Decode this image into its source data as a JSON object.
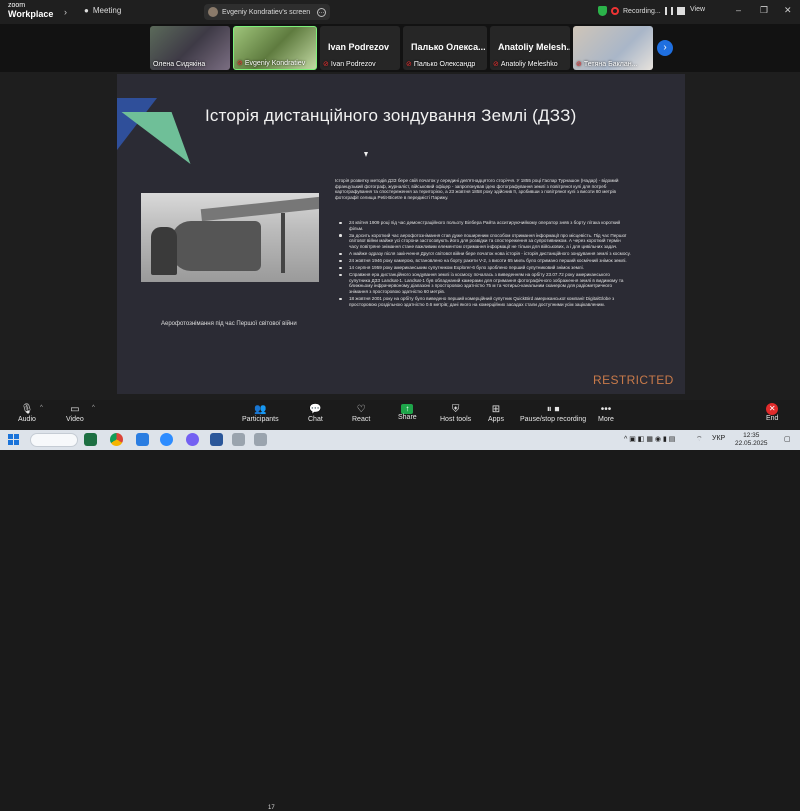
{
  "app": {
    "logo_line1": "zoom",
    "logo_line2": "Workplace",
    "meeting_label": "Meeting",
    "screen_pill": "Evgeniy Kondratiev's screen",
    "recording_label": "Recording...",
    "view_label": "View"
  },
  "participants": [
    {
      "name": "Олена Сидякіна",
      "muted": false
    },
    {
      "name": "Evgeniy Kondratiev",
      "muted": true
    },
    {
      "name": "Ivan Podrezov",
      "big": "Ivan Podrezov",
      "muted": true
    },
    {
      "name": "Палько Олександр",
      "big": "Палько Олекса...",
      "muted": true
    },
    {
      "name": "Anatoliy Meleshko",
      "big": "Anatoliy Melesh...",
      "muted": true
    },
    {
      "name": "Тетяна Баклан...",
      "muted": true
    }
  ],
  "slide": {
    "title": "Історія дистанційного зондування Землі (ДЗЗ)",
    "photo_caption": "Аерофотознімання під час Першої світової війни",
    "intro": "Історія розвитку методів ДЗЗ бере свій початок у середині дев'ятнадцятого сторіччя. У 1855 році Гаспар Турнашон (Надар) - відомий французький фотограф, журналіст, військовий офіцер - запропонував ідею фотографування землі з повітряної кулі для потреб картографування та спостереження за територією, а 23 жовтня 1858 року здійснив її, зробивши з повітряної кулі з висоти 80 метрів фотографії селища Petit-Bicetre в передмісті Парижу.",
    "bullets": [
      "24 квітня 1909 році під час демонстраційного польоту Вілбера Райта асситируючийкому оператор зняв з борту літака короткий фільм.",
      "За досить короткий час аерофотознімання став дуже поширеним способом отримання інформації про місцевість. Під час Першої світової війни майже усі сторони застосовують його для розвідки та спостереження за супротивником. А через короткий термін часу повітряне знімання стане важливим елементом отримання інформації не тільки для військових, а і для цивільних задач.",
      "А майже одразу після закінчення Другої світової війни бере початок нова історія - історія дистанційного зондування землі з космосу.",
      "24 жовтня 1946 року камерою, встановлено на борту ракети V-2, з висоти 65 миль було отримано перший космічний знімок землі.",
      "14 серпня 1959 року американським супутником Explorer-6 було зроблено перший супутниковий знімок землі.",
      "Справжня ера дистанційного зондування землі із космосу почалась з виведенням на орбіту 23.07.72 року американського супутника ДЗЗ Landsat-1. Landsat-1 був обладнаний камерами для отримання фотографічного зображення землі в видимому та ближньому інфрачервоному діапазоні з просторовою здатністю 75 м та чотирьо-канальним сканером для радіометричного знімання з просторовою здатністю 60 метрів.",
      "18 жовтня 2001 року на орбіту було виведено перший комерційний супутник QuickBird американської компанії DigitalGlobe з просторовою роздільною здатністю 0.6 метрів; дані якого на комерційних засадах стали доступними усім зацікавленим."
    ],
    "restricted_label": "RESTRICTED"
  },
  "toolbar": {
    "participants_count": "17",
    "items": [
      {
        "label": "Audio",
        "icon": "microphone-icon"
      },
      {
        "label": "Video",
        "icon": "video-camera-icon"
      },
      {
        "label": "Participants",
        "icon": "participants-icon"
      },
      {
        "label": "Chat",
        "icon": "chat-icon"
      },
      {
        "label": "React",
        "icon": "heart-icon"
      },
      {
        "label": "Share",
        "icon": "share-arrow-icon"
      },
      {
        "label": "Host tools",
        "icon": "shield-icon"
      },
      {
        "label": "Apps",
        "icon": "apps-icon"
      },
      {
        "label": "Pause/stop recording",
        "icon": "pause-stop-icon"
      },
      {
        "label": "More",
        "icon": "more-icon"
      },
      {
        "label": "End",
        "icon": "end-call-icon"
      }
    ]
  },
  "taskbar": {
    "language": "УКР",
    "time": "12:35",
    "date": "22.05.2025"
  },
  "colors": {
    "accent_blue": "#1f6fe0",
    "share_green": "#1ea54a",
    "end_red": "#e02b2b",
    "restricted_orange": "#c87a4a",
    "slide_bg": "#2b2b34"
  }
}
